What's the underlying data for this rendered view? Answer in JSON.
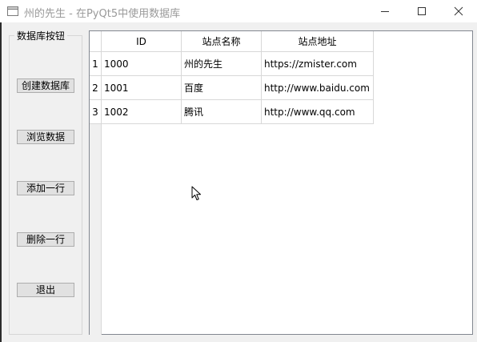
{
  "window": {
    "title": "州的先生 - 在PyQt5中使用数据库",
    "controls": [
      "minimize-icon",
      "maximize-icon",
      "close-icon"
    ]
  },
  "groupbox": {
    "title": "数据库按钮",
    "buttons": {
      "create": "创建数据库",
      "browse": "浏览数据",
      "add_row": "添加一行",
      "delete_row": "删除一行",
      "exit": "退出"
    }
  },
  "table": {
    "headers": [
      "ID",
      "站点名称",
      "站点地址"
    ],
    "row_numbers": [
      "1",
      "2",
      "3"
    ],
    "rows": [
      [
        "1000",
        "州的先生",
        "https://zmister.com"
      ],
      [
        "1001",
        "百度",
        "http://www.baidu.com"
      ],
      [
        "1002",
        "腾讯",
        "http://www.qq.com"
      ]
    ]
  },
  "colors": {
    "titlebar_bg": "#ffffff",
    "window_bg": "#f0f0f0",
    "table_border": "#828790",
    "button_bg": "#e1e1e1"
  }
}
